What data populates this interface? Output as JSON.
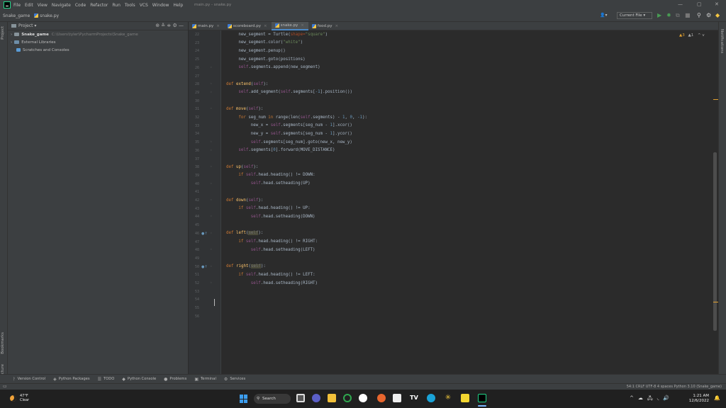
{
  "menu": [
    "File",
    "Edit",
    "View",
    "Navigate",
    "Code",
    "Refactor",
    "Run",
    "Tools",
    "VCS",
    "Window",
    "Help"
  ],
  "window_title": "main.py - snake.py",
  "window_controls": {
    "minimize": "—",
    "restore": "▢",
    "close": "✕"
  },
  "breadcrumb": {
    "project": "Snake_game",
    "file": "snake.py"
  },
  "toolbar": {
    "run_config": "Current File ▾",
    "user_icon": "👤▾"
  },
  "project_panel": {
    "title": "Project ▾",
    "items": [
      {
        "label": "Snake_game",
        "path": "C:\\Users\\tyler\\PycharmProjects\\Snake_game"
      },
      {
        "label": "External Libraries"
      },
      {
        "label": "Scratches and Consoles"
      }
    ]
  },
  "left_strip": {
    "project": "Project",
    "bookmarks": "Bookmarks",
    "structure": "Structure"
  },
  "right_strip": {
    "notifications": "Notifications"
  },
  "tabs": [
    {
      "label": "main.py",
      "active": false
    },
    {
      "label": "scoreboard.py",
      "active": false
    },
    {
      "label": "snake.py",
      "active": true
    },
    {
      "label": "food.py",
      "active": false
    }
  ],
  "inspection": {
    "warnings": "▲3",
    "weak": "▲1",
    "nav": "^ v"
  },
  "line_numbers": [
    "22",
    "23",
    "24",
    "25",
    "26",
    "27",
    "28",
    "29",
    "30",
    "31",
    "32",
    "33",
    "34",
    "35",
    "36",
    "37",
    "38",
    "39",
    "40",
    "41",
    "42",
    "43",
    "44",
    "45",
    "46",
    "47",
    "48",
    "49",
    "50",
    "51",
    "52",
    "53",
    "54",
    "55",
    "56"
  ],
  "code_lines": {
    "l22": [
      "new_segment = Turtle(",
      "shape=",
      "\"square\"",
      ")"
    ],
    "l23": [
      "new_segment.color(",
      "\"white\"",
      ")"
    ],
    "l24": [
      "new_segment.penup()"
    ],
    "l25": [
      "new_segment.goto(positions)"
    ],
    "l26": [
      "self",
      ".segments.append(new_segment)"
    ],
    "l28": [
      "def ",
      "extend",
      "(",
      "self",
      "):"
    ],
    "l29": [
      "self",
      ".add_segment(",
      "self",
      ".segments[",
      "-1",
      "].position())"
    ],
    "l31": [
      "def ",
      "move",
      "(",
      "self",
      "):"
    ],
    "l32": [
      "for ",
      "seg_num ",
      "in ",
      "range(len(",
      "self",
      ".segments) - ",
      "1",
      ", ",
      "0",
      ", ",
      "-1",
      "):"
    ],
    "l33": [
      "new_x = ",
      "self",
      ".segments[seg_num - ",
      "1",
      "].xcor()"
    ],
    "l34": [
      "new_y = ",
      "self",
      ".segments[seg_num - ",
      "1",
      "].ycor()"
    ],
    "l35": [
      "self",
      ".segments[seg_num].goto(new_x, new_y)"
    ],
    "l36": [
      "self",
      ".segments[",
      "0",
      "].forward(MOVE_DISTANCE)"
    ],
    "l38": [
      "def ",
      "up",
      "(",
      "self",
      "):"
    ],
    "l39": [
      "if ",
      "self",
      ".head.heading() != DOWN:"
    ],
    "l40": [
      "self",
      ".head.setheading(UP)"
    ],
    "l42": [
      "def ",
      "down",
      "(",
      "self",
      "):"
    ],
    "l43": [
      "if ",
      "self",
      ".head.heading() != UP:"
    ],
    "l44": [
      "self",
      ".head.setheading(DOWN)"
    ],
    "l46": [
      "def ",
      "left",
      "(",
      "self",
      "):"
    ],
    "l47": [
      "if ",
      "self",
      ".head.heading() != RIGHT:"
    ],
    "l48": [
      "self",
      ".head.setheading(LEFT)"
    ],
    "l50": [
      "def ",
      "right",
      "(",
      "self",
      "):"
    ],
    "l51": [
      "if ",
      "self",
      ".head.heading() != LEFT:"
    ],
    "l52": [
      "self",
      ".head.setheading(RIGHT)"
    ]
  },
  "bottom_tabs": [
    {
      "icon": "ᚹ",
      "label": "Version Control"
    },
    {
      "icon": "◈",
      "label": "Python Packages"
    },
    {
      "icon": "☰",
      "label": "TODO"
    },
    {
      "icon": "◆",
      "label": "Python Console"
    },
    {
      "icon": "●",
      "label": "Problems"
    },
    {
      "icon": "▣",
      "label": "Terminal"
    },
    {
      "icon": "⚙",
      "label": "Services"
    }
  ],
  "status": {
    "text": "54:1   CRLF   UTF-8   4 spaces   Python 3.10 (Snake_game)"
  },
  "taskbar": {
    "weather_temp": "47°F",
    "weather_desc": "Clear",
    "search": "Search",
    "time": "1:21 AM",
    "date": "12/6/2022",
    "tray": [
      "^",
      "☁",
      "🖧",
      "◟",
      "🔊"
    ],
    "bell": "🔔"
  }
}
